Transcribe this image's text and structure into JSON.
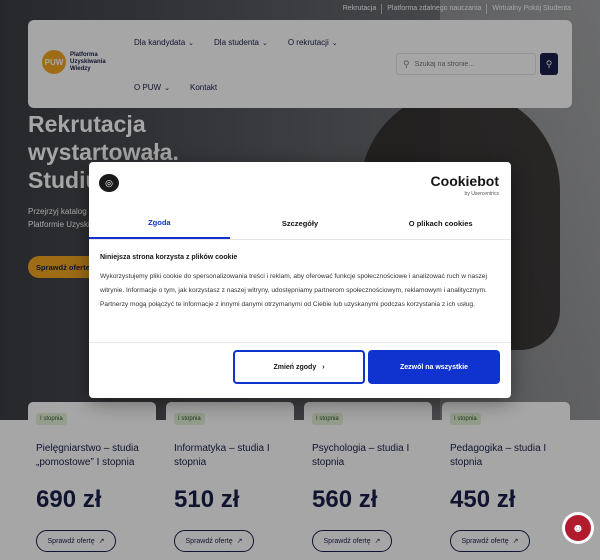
{
  "topbar": [
    "Rekrutacja",
    "Platforma zdalnego nauczania",
    "Wirtualny Pokój Studenta"
  ],
  "logo": {
    "badge": "PUW",
    "text": "Platforma Uzyskiwania Wiedzy"
  },
  "nav": {
    "row1": [
      "Dla kandydata",
      "Dla studenta",
      "O rekrutacji"
    ],
    "row2_dropdown": "O PUW",
    "row2_link": "Kontakt"
  },
  "search": {
    "placeholder": "Szukaj na stronie..."
  },
  "hero": {
    "title": "Rekrutacja wystartowała. Studiuj na swo",
    "desc1": "Przejrzyj katalog k",
    "desc2": "Platformie Uzyskiw",
    "button": "Sprawdź oferte"
  },
  "cards": [
    {
      "badge": "I stopnia",
      "title": "Pielęgniarstwo – studia „pomostowe” I stopnia",
      "price": "690 zł",
      "button": "Sprawdź ofertę"
    },
    {
      "badge": "I stopnia",
      "title": "Informatyka – studia I stopnia",
      "price": "510 zł",
      "button": "Sprawdź ofertę"
    },
    {
      "badge": "I stopnia",
      "title": "Psychologia – studia I stopnia",
      "price": "560 zł",
      "button": "Sprawdź ofertę"
    },
    {
      "badge": "I stopnia",
      "title": "Pedagogika – studia I stopnia",
      "price": "450 zł",
      "button": "Sprawdź ofertę"
    }
  ],
  "cookie": {
    "brand": "Cookiebot",
    "brand_sub": "by Usercentrics",
    "tabs": [
      "Zgoda",
      "Szczegóły",
      "O plikach cookies"
    ],
    "title": "Niniejsza strona korzysta z plików cookie",
    "text": "Wykorzystujemy pliki cookie do spersonalizowania treści i reklam, aby oferować funkcje społecznościowe i analizować ruch w naszej witrynie. Informacje o tym, jak korzystasz z naszej witryny, udostępniamy partnerom społecznościowym, reklamowym i analitycznym. Partnerzy mogą połączyć te informacje z innymi danymi otrzymanymi od Ciebie lub uzyskanymi podczas korzystania z ich usług.",
    "btn_change": "Zmień zgody",
    "btn_allow": "Zezwól na wszystkie"
  },
  "colors": {
    "primary": "#1a1f4b",
    "accent": "#f5a623",
    "cookie_blue": "#1032cf",
    "access_red": "#b01c2e"
  }
}
